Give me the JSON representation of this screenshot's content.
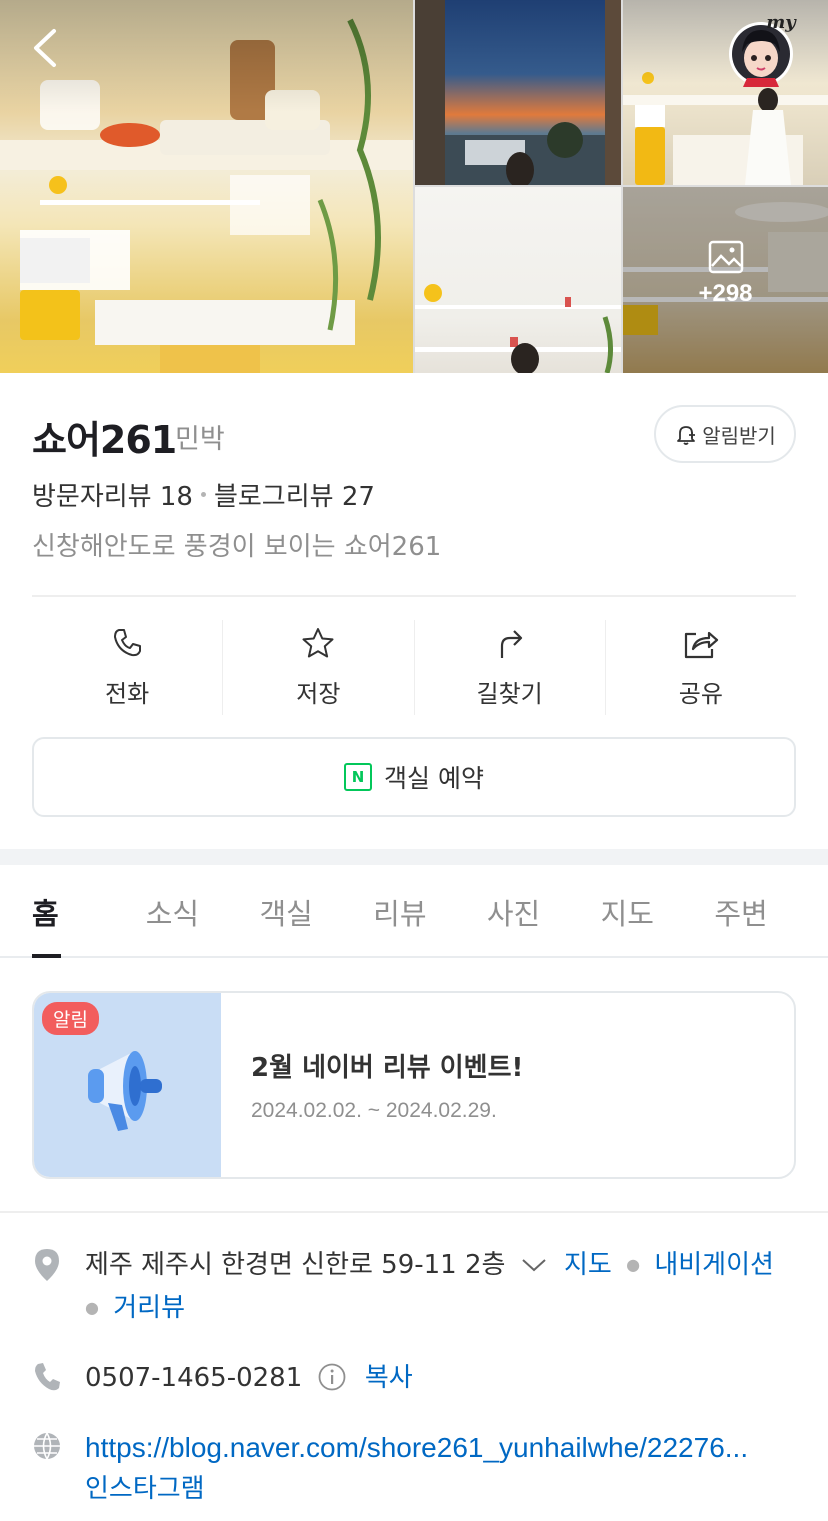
{
  "place": {
    "name": "쇼어261",
    "category": "민박",
    "alarm_label": "알림받기",
    "visitor_reviews": "방문자리뷰 18",
    "blog_reviews": "블로그리뷰 27",
    "description": "신창해안도로 풍경이 보이는 쇼어261"
  },
  "gallery": {
    "more_count": "+298"
  },
  "avatar": {
    "label": "my"
  },
  "actions": [
    {
      "label": "전화",
      "icon": "phone-icon"
    },
    {
      "label": "저장",
      "icon": "star-icon"
    },
    {
      "label": "길찾기",
      "icon": "directions-icon"
    },
    {
      "label": "공유",
      "icon": "share-icon"
    }
  ],
  "reserve": {
    "label": "객실 예약",
    "badge": "N"
  },
  "tabs": [
    "홈",
    "소식",
    "객실",
    "리뷰",
    "사진",
    "지도",
    "주변"
  ],
  "notice": {
    "badge": "알림",
    "title": "2월 네이버 리뷰 이벤트!",
    "date": "2024.02.02. ~ 2024.02.29."
  },
  "info": {
    "address": "제주 제주시 한경면 신한로 59-11 2층",
    "map_link": "지도",
    "nav_link": "내비게이션",
    "street_link": "거리뷰",
    "phone": "0507-1465-0281",
    "copy_label": "복사",
    "website": "https://blog.naver.com/shore261_yunhailwhe/22276...",
    "instagram": "인스타그램"
  },
  "colors": {
    "accent": "#0068c3",
    "naver_green": "#03c75a",
    "badge_red": "#f25d5d"
  }
}
